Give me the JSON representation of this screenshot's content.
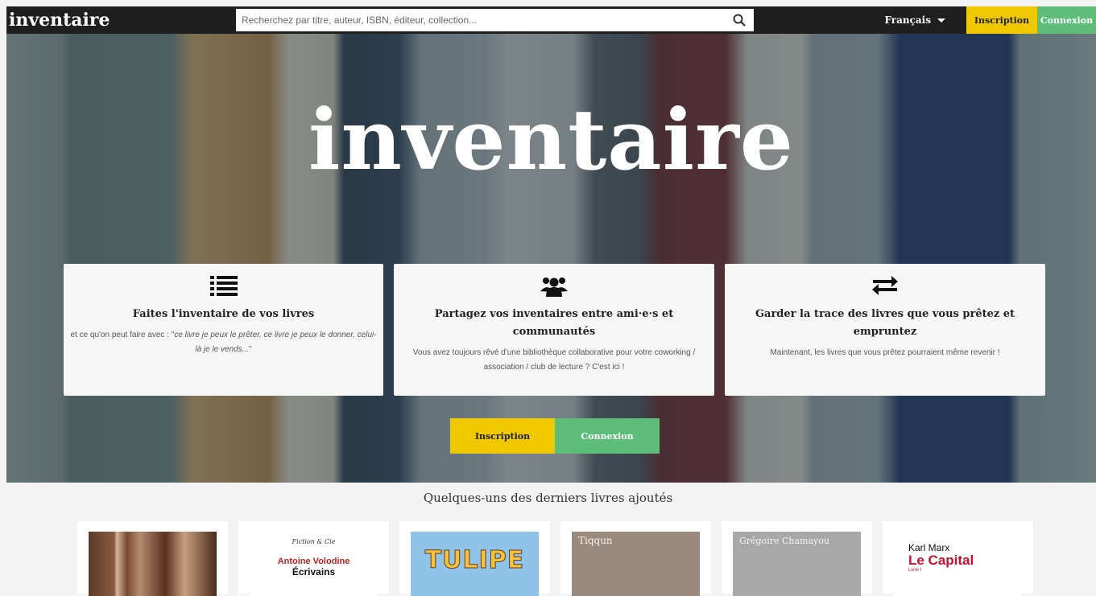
{
  "header": {
    "logo": "inventaire",
    "search_placeholder": "Recherchez par titre, auteur, ISBN, éditeur, collection...",
    "language": "Français",
    "signup_label": "Inscription",
    "login_label": "Connexion"
  },
  "hero": {
    "title": "inventaire",
    "cards": [
      {
        "icon": "list-icon",
        "title": "Faites l'inventaire de vos livres",
        "text_prefix": "et ce qu'on peut faire avec : \"",
        "text_italic": "ce livre je peux le prêter, ce livre je peux le donner, celui-là je le vends...",
        "text_suffix": "\""
      },
      {
        "icon": "users-icon",
        "title": "Partagez vos inventaires entre ami·e·s et communautés",
        "text": "Vous avez toujours rêvé d'une bibliothèque collaborative pour votre coworking / association / club de lecture ? C'est ici !"
      },
      {
        "icon": "exchange-icon",
        "title": "Garder la trace des livres que vous prêtez et empruntez",
        "text": "Maintenant, les livres que vous prêtez pourraient même revenir !"
      }
    ],
    "signup_label": "Inscription",
    "login_label": "Connexion"
  },
  "latest": {
    "title": "Quelques-uns des derniers livres ajoutés",
    "books": [
      {
        "cover_text": ""
      },
      {
        "series": "Fiction & Cie",
        "author": "Antoine Volodine",
        "title": "Écrivains"
      },
      {
        "title": "TULIPE"
      },
      {
        "author": "Tiqqun"
      },
      {
        "author": "Grégoire Chamayou"
      },
      {
        "author": "Karl Marx",
        "title": "Le Capital",
        "sub": "Livre I"
      }
    ]
  },
  "colors": {
    "topbar": "#1f1f1f",
    "signup": "#f0c800",
    "login": "#5ebd79"
  }
}
